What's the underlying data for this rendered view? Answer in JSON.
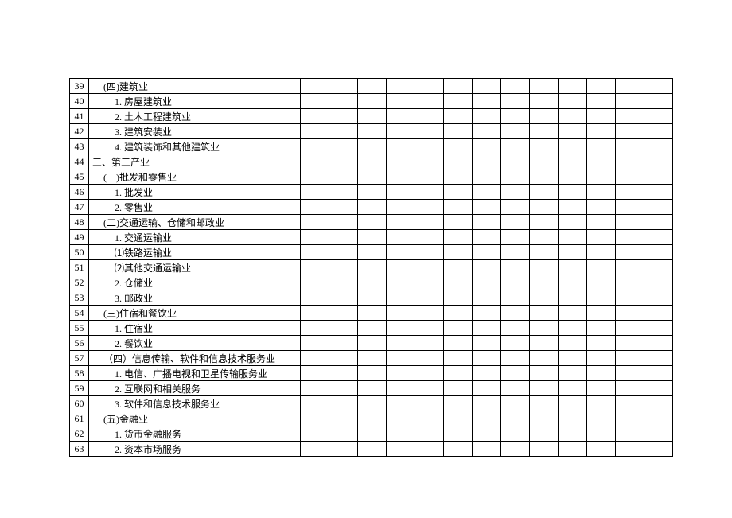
{
  "rows": [
    {
      "num": "39",
      "label": "(四)建筑业"
    },
    {
      "num": "40",
      "label": "1. 房屋建筑业"
    },
    {
      "num": "41",
      "label": "2. 土木工程建筑业"
    },
    {
      "num": "42",
      "label": "3. 建筑安装业"
    },
    {
      "num": "43",
      "label": "4. 建筑装饰和其他建筑业"
    },
    {
      "num": "44",
      "label": "三、第三产业"
    },
    {
      "num": "45",
      "label": "(一)批发和零售业"
    },
    {
      "num": "46",
      "label": "1. 批发业"
    },
    {
      "num": "47",
      "label": "2. 零售业"
    },
    {
      "num": "48",
      "label": "(二)交通运输、仓储和邮政业"
    },
    {
      "num": "49",
      "label": "1. 交通运输业"
    },
    {
      "num": "50",
      "label": "⑴铁路运输业"
    },
    {
      "num": "51",
      "label": "⑵其他交通运输业"
    },
    {
      "num": "52",
      "label": "2. 仓储业"
    },
    {
      "num": "53",
      "label": "3. 邮政业"
    },
    {
      "num": "54",
      "label": "(三)住宿和餐饮业"
    },
    {
      "num": "55",
      "label": "1. 住宿业"
    },
    {
      "num": "56",
      "label": "2. 餐饮业"
    },
    {
      "num": "57",
      "label": "（四）信息传输、软件和信息技术服务业"
    },
    {
      "num": "58",
      "label": "1. 电信、广播电视和卫星传输服务业"
    },
    {
      "num": "59",
      "label": "2. 互联网和相关服务"
    },
    {
      "num": "60",
      "label": "3. 软件和信息技术服务业"
    },
    {
      "num": "61",
      "label": "(五)金融业"
    },
    {
      "num": "62",
      "label": "1. 货币金融服务"
    },
    {
      "num": "63",
      "label": "2. 资本市场服务"
    }
  ],
  "indents": {
    "39": 1,
    "40": 2,
    "41": 2,
    "42": 2,
    "43": 2,
    "44": 0,
    "45": 1,
    "46": 2,
    "47": 2,
    "48": 1,
    "49": 2,
    "50": 2,
    "51": 2,
    "52": 2,
    "53": 2,
    "54": 1,
    "55": 2,
    "56": 2,
    "57": 1,
    "58": 2,
    "59": 2,
    "60": 2,
    "61": 1,
    "62": 2,
    "63": 2
  },
  "dataColumnCount": 13
}
